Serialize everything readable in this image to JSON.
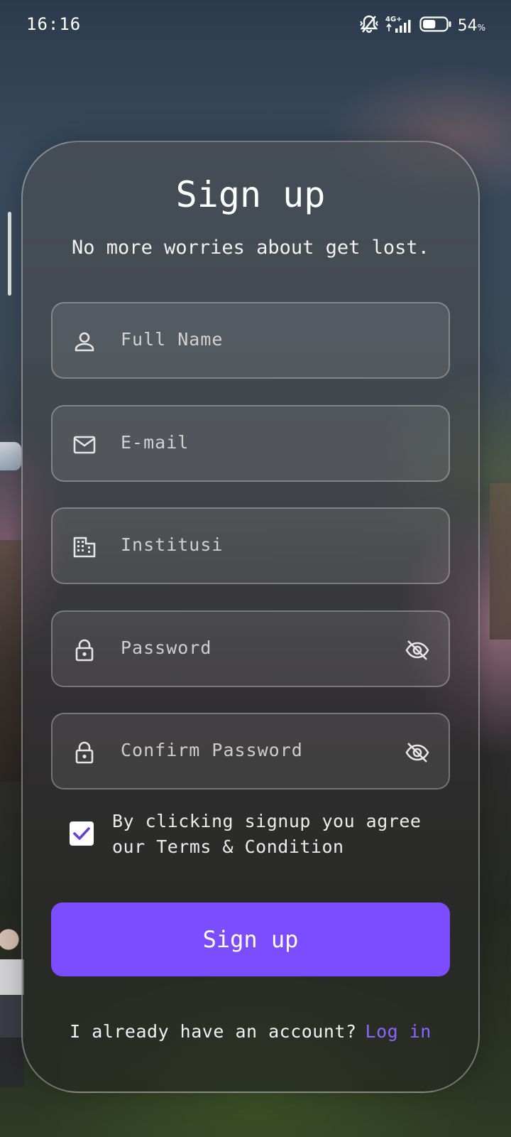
{
  "status_bar": {
    "time": "16:16",
    "network": "4G+",
    "battery_percent": "54",
    "battery_unit": "%",
    "battery_level": 0.54,
    "icons": [
      "mute-vibrate-icon",
      "signal-icon",
      "battery-icon"
    ]
  },
  "signup": {
    "title": "Sign up",
    "subtitle": "No more worries about get lost.",
    "fields": {
      "full_name": {
        "placeholder": "Full Name",
        "icon": "person-icon"
      },
      "email": {
        "placeholder": "E-mail",
        "icon": "mail-icon"
      },
      "institution": {
        "placeholder": "Institusi",
        "icon": "building-icon"
      },
      "password": {
        "placeholder": "Password",
        "icon": "lock-icon",
        "toggle_icon": "eye-off-icon"
      },
      "confirm_password": {
        "placeholder": "Confirm Password",
        "icon": "lock-icon",
        "toggle_icon": "eye-off-icon"
      }
    },
    "agreement": {
      "checked": true,
      "text": "By clicking signup you agree our Terms & Condition"
    },
    "submit_label": "Sign up",
    "login_prompt": "I already have an account?",
    "login_link": "Log in"
  },
  "colors": {
    "accent": "#7c4dff",
    "link": "#8c64ff",
    "checkmark": "#6a3fd8"
  }
}
